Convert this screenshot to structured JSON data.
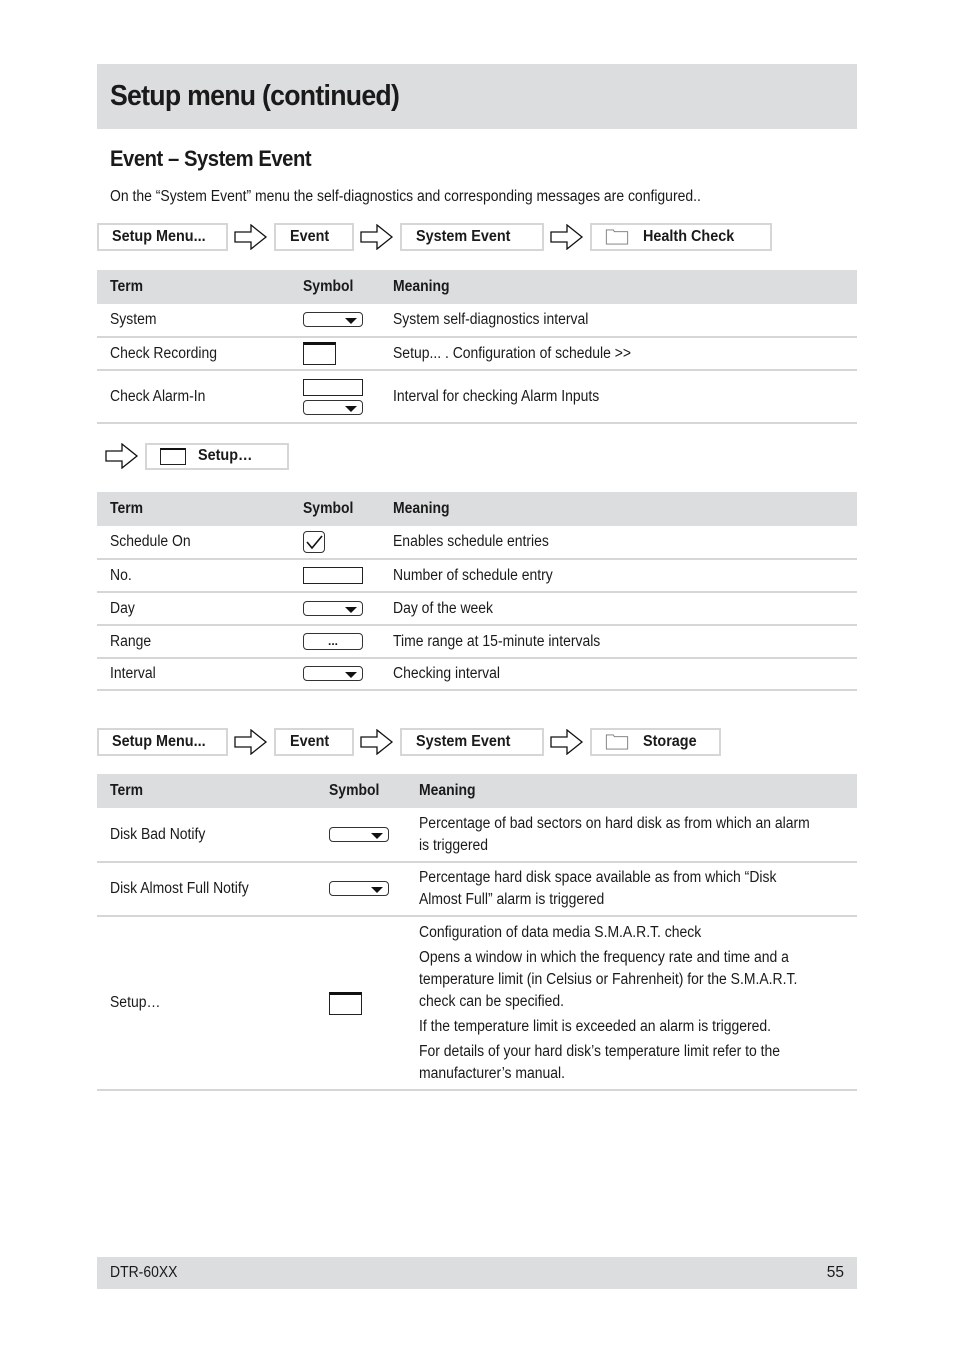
{
  "page": {
    "title": "Setup menu (continued)",
    "section_title": "Event – System Event",
    "intro": "On the “System Event” menu the self-diagnostics and corresponding messages are configured.."
  },
  "breadcrumb_health": {
    "items": [
      "Setup Menu...",
      "Event",
      "System Event",
      "Health Check"
    ],
    "icons": [
      "arrow-right-icon",
      "folder-icon"
    ]
  },
  "table_health": {
    "headers": [
      "Term",
      "Symbol",
      "Meaning"
    ],
    "rows": [
      {
        "term": "System",
        "symbol": "dropdown",
        "meaning": "System self-diagnostics interval"
      },
      {
        "term": "Check Recording",
        "symbol": "window-button",
        "meaning": "Setup... . Configuration of schedule >>"
      },
      {
        "term": "Check Alarm-In",
        "symbol": "field+dropdown",
        "meaning": "Interval for checking Alarm Inputs"
      }
    ]
  },
  "breadcrumb_setup": {
    "items": [
      "Setup…"
    ]
  },
  "table_setup": {
    "headers": [
      "Term",
      "Symbol",
      "Meaning"
    ],
    "rows": [
      {
        "term": "Schedule On",
        "symbol": "checkbox-checked",
        "meaning": "Enables schedule entries"
      },
      {
        "term": "No.",
        "symbol": "text-field",
        "meaning": "Number of schedule entry"
      },
      {
        "term": "Day",
        "symbol": "dropdown",
        "meaning": "Day of the week"
      },
      {
        "term": "Range",
        "symbol": "ellipsis-button",
        "symbol_text": "...",
        "meaning": "Time range at 15-minute intervals"
      },
      {
        "term": "Interval",
        "symbol": "dropdown",
        "meaning": "Checking interval"
      }
    ]
  },
  "breadcrumb_storage": {
    "items": [
      "Setup Menu...",
      "Event",
      "System Event",
      "Storage"
    ]
  },
  "table_storage": {
    "headers": [
      "Term",
      "Symbol",
      "Meaning"
    ],
    "rows": [
      {
        "term": "Disk Bad Notify",
        "symbol": "dropdown",
        "meaning": [
          "Percentage of bad sectors on hard disk as from which an alarm",
          "is triggered"
        ]
      },
      {
        "term": "Disk Almost Full Notify",
        "symbol": "dropdown",
        "meaning": [
          "Percentage hard disk space available as from which “Disk",
          "Almost Full” alarm is triggered"
        ]
      },
      {
        "term": "Setup…",
        "symbol": "window-button",
        "meaning": [
          "Configuration of data media S.M.A.R.T. check",
          "Opens a window in which the frequency rate and time and a",
          "temperature limit (in Celsius or Fahrenheit) for the S.M.A.R.T.",
          "check can be specified.",
          "If the temperature limit is exceeded an alarm is triggered.",
          "For details of your hard disk’s temperature limit refer to the",
          "manufacturer’s manual."
        ]
      }
    ]
  },
  "footer": {
    "model": "DTR-60XX",
    "page_number": "55"
  }
}
